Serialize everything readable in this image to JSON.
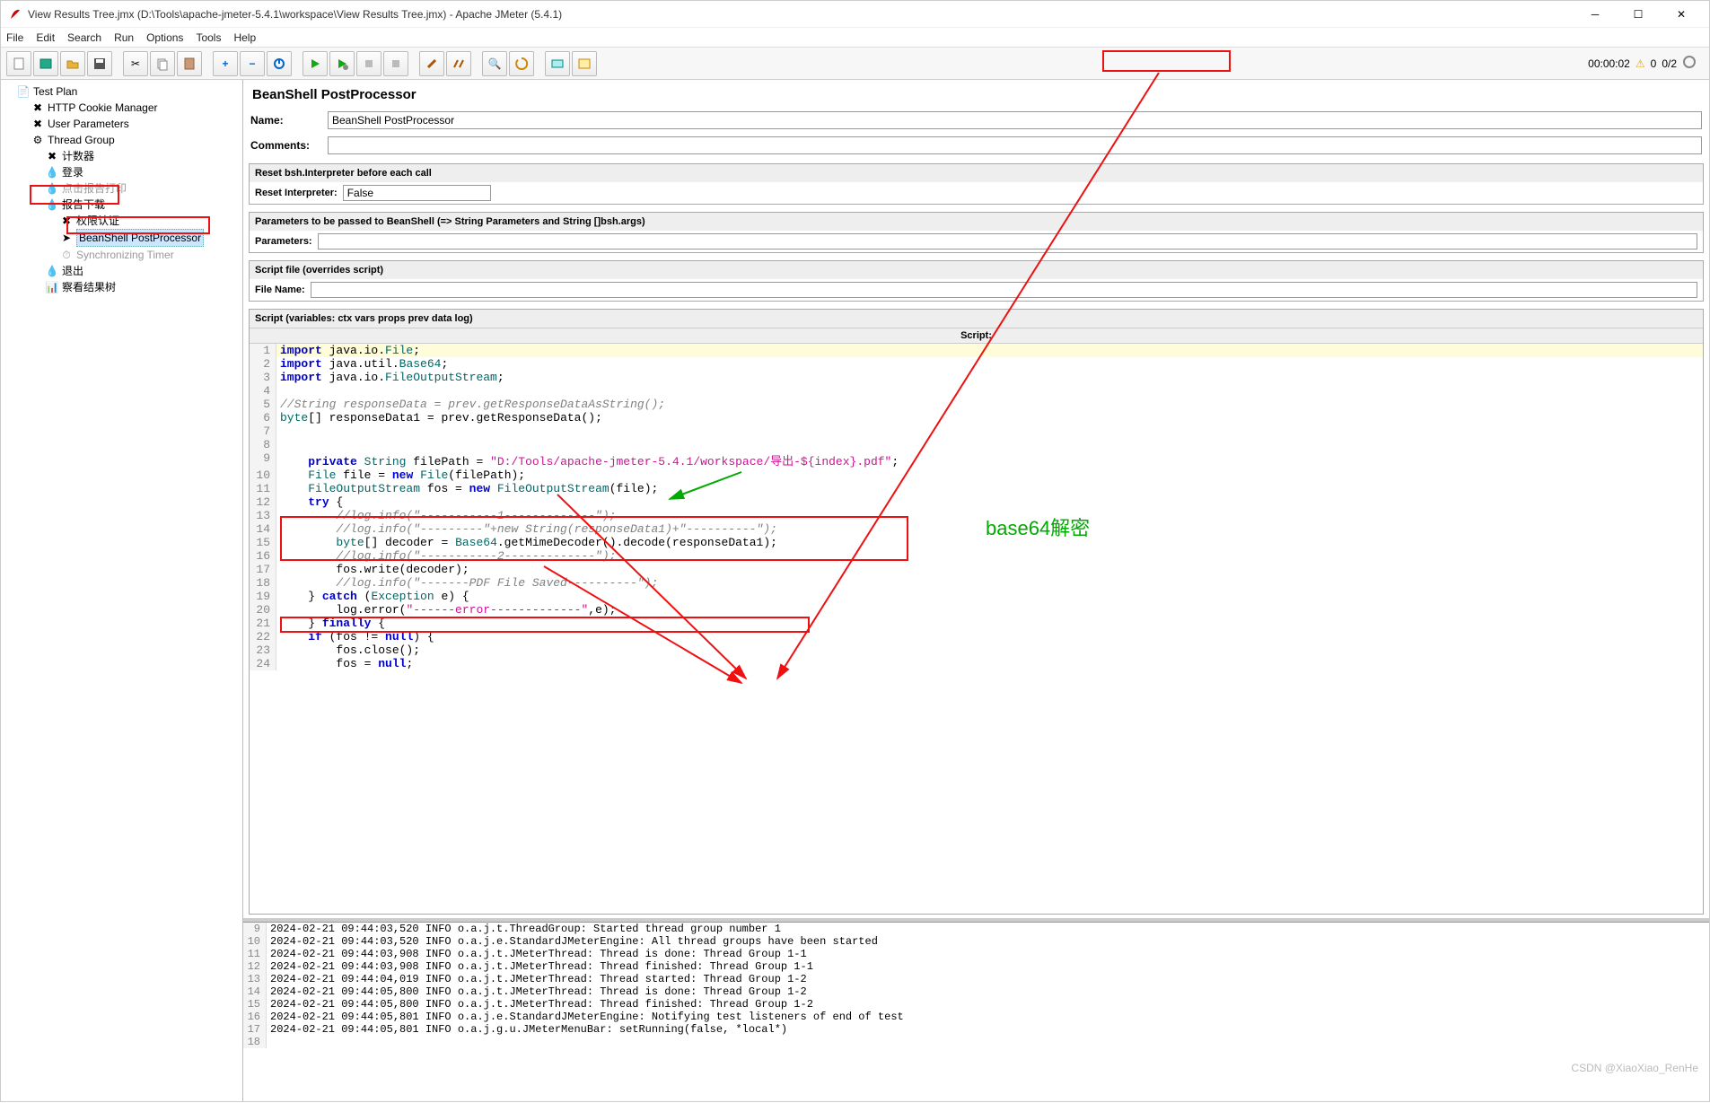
{
  "window": {
    "title": "View Results Tree.jmx (D:\\Tools\\apache-jmeter-5.4.1\\workspace\\View Results Tree.jmx) - Apache JMeter (5.4.1)"
  },
  "menubar": [
    "File",
    "Edit",
    "Search",
    "Run",
    "Options",
    "Tools",
    "Help"
  ],
  "status": {
    "time": "00:00:02",
    "threads": "0",
    "total": "0/2"
  },
  "tree": {
    "root": "Test Plan",
    "items": [
      "HTTP Cookie Manager",
      "User Parameters",
      "Thread Group"
    ],
    "tg_children": [
      "计数器",
      "登录",
      "点击报告打印",
      "报告下载",
      "退出",
      "察看结果树"
    ],
    "report_children": [
      "权限认证",
      "BeanShell PostProcessor",
      "Synchronizing Timer"
    ]
  },
  "editor": {
    "heading": "BeanShell PostProcessor",
    "name_label": "Name:",
    "name_value": "BeanShell PostProcessor",
    "comments_label": "Comments:",
    "comments_value": "",
    "reset_section": "Reset bsh.Interpreter before each call",
    "reset_label": "Reset Interpreter:",
    "reset_value": "False",
    "params_section": "Parameters to be passed to BeanShell (=> String Parameters and String []bsh.args)",
    "params_label": "Parameters:",
    "params_value": "",
    "scriptfile_section": "Script file (overrides script)",
    "filename_label": "File Name:",
    "filename_value": "",
    "script_section": "Script (variables: ctx vars props prev data log)",
    "script_label": "Script:"
  },
  "annotation": {
    "label": "base64解密"
  },
  "code": [
    {
      "n": 1,
      "h": true,
      "t": "import java.io.File;"
    },
    {
      "n": 2,
      "t": "import java.util.Base64;"
    },
    {
      "n": 3,
      "t": "import java.io.FileOutputStream;"
    },
    {
      "n": 4,
      "t": ""
    },
    {
      "n": 5,
      "t": "//String responseData = prev.getResponseDataAsString();"
    },
    {
      "n": 6,
      "t": "byte[] responseData1 = prev.getResponseData();"
    },
    {
      "n": 7,
      "t": ""
    },
    {
      "n": 8,
      "t": ""
    },
    {
      "n": 9,
      "t": "    private String filePath = \"D:/Tools/apache-jmeter-5.4.1/workspace/导出-${index}.pdf\";"
    },
    {
      "n": 10,
      "t": "    File file = new File(filePath);"
    },
    {
      "n": 11,
      "t": "    FileOutputStream fos = new FileOutputStream(file);"
    },
    {
      "n": 12,
      "t": "    try {"
    },
    {
      "n": 13,
      "t": "        //log.info(\"-----------1-------------\");"
    },
    {
      "n": 14,
      "t": "        //log.info(\"---------\"+new String(responseData1)+\"----------\");"
    },
    {
      "n": 15,
      "t": "        byte[] decoder = Base64.getMimeDecoder().decode(responseData1);"
    },
    {
      "n": 16,
      "t": "        //log.info(\"-----------2-------------\");"
    },
    {
      "n": 17,
      "t": "        fos.write(decoder);"
    },
    {
      "n": 18,
      "t": "        //log.info(\"-------PDF File Saved----------\");"
    },
    {
      "n": 19,
      "t": "    } catch (Exception e) {"
    },
    {
      "n": 20,
      "t": "        log.error(\"------error-------------\",e);"
    },
    {
      "n": 21,
      "t": "    } finally {"
    },
    {
      "n": 22,
      "t": "    if (fos != null) {"
    },
    {
      "n": 23,
      "t": "        fos.close();"
    },
    {
      "n": 24,
      "t": "        fos = null;"
    }
  ],
  "log": [
    {
      "n": 9,
      "t": "2024-02-21 09:44:03,520 INFO o.a.j.t.ThreadGroup: Started thread group number 1"
    },
    {
      "n": 10,
      "t": "2024-02-21 09:44:03,520 INFO o.a.j.e.StandardJMeterEngine: All thread groups have been started"
    },
    {
      "n": 11,
      "t": "2024-02-21 09:44:03,908 INFO o.a.j.t.JMeterThread: Thread is done: Thread Group 1-1"
    },
    {
      "n": 12,
      "t": "2024-02-21 09:44:03,908 INFO o.a.j.t.JMeterThread: Thread finished: Thread Group 1-1"
    },
    {
      "n": 13,
      "t": "2024-02-21 09:44:04,019 INFO o.a.j.t.JMeterThread: Thread started: Thread Group 1-2"
    },
    {
      "n": 14,
      "t": "2024-02-21 09:44:05,800 INFO o.a.j.t.JMeterThread: Thread is done: Thread Group 1-2"
    },
    {
      "n": 15,
      "t": "2024-02-21 09:44:05,800 INFO o.a.j.t.JMeterThread: Thread finished: Thread Group 1-2"
    },
    {
      "n": 16,
      "t": "2024-02-21 09:44:05,801 INFO o.a.j.e.StandardJMeterEngine: Notifying test listeners of end of test"
    },
    {
      "n": 17,
      "t": "2024-02-21 09:44:05,801 INFO o.a.j.g.u.JMeterMenuBar: setRunning(false, *local*)"
    },
    {
      "n": 18,
      "t": ""
    }
  ],
  "watermark": "CSDN @XiaoXiao_RenHe"
}
